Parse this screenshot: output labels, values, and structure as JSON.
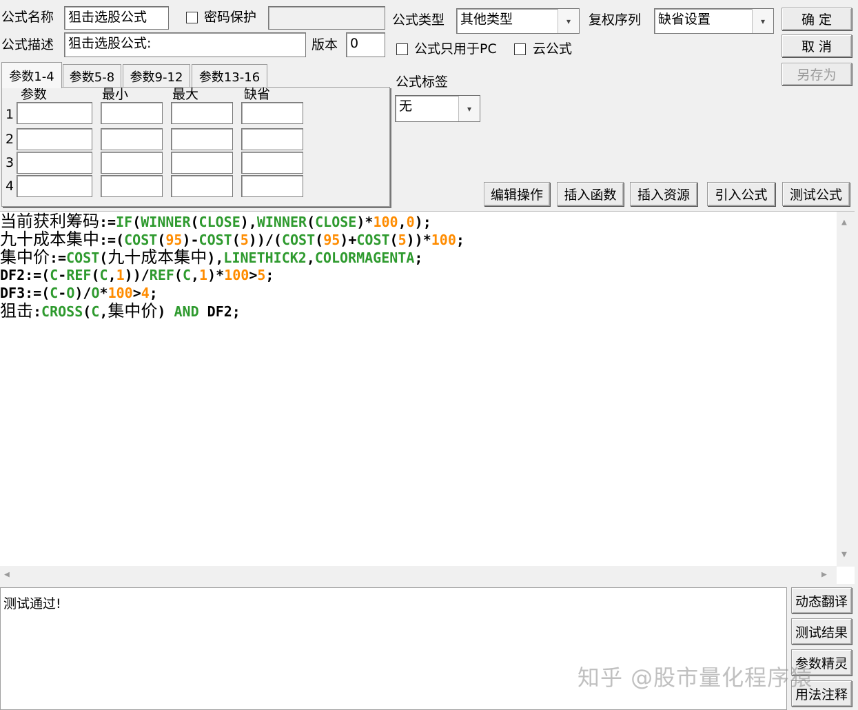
{
  "header": {
    "name_label": "公式名称",
    "name_value": "狙击选股公式",
    "password_label": "密码保护",
    "desc_label": "公式描述",
    "desc_value": "狙击选股公式:",
    "version_label": "版本",
    "version_value": "0",
    "type_label": "公式类型",
    "type_value": "其他类型",
    "rights_label": "复权序列",
    "rights_value": "缺省设置",
    "pc_only_label": "公式只用于PC",
    "cloud_label": "云公式",
    "tag_label": "公式标签",
    "tag_value": "无"
  },
  "buttons": {
    "ok": "确  定",
    "cancel": "取  消",
    "save_as": "另存为",
    "edit_ops": "编辑操作",
    "insert_func": "插入函数",
    "insert_res": "插入资源",
    "import_formula": "引入公式",
    "test_formula": "测试公式",
    "dyn_translate": "动态翻译",
    "test_result": "测试结果",
    "param_wizard": "参数精灵",
    "usage_notes": "用法注释"
  },
  "tabs": [
    "参数1-4",
    "参数5-8",
    "参数9-12",
    "参数13-16"
  ],
  "params": {
    "headers": [
      "参数",
      "最小",
      "最大",
      "缺省"
    ],
    "rows": [
      "1",
      "2",
      "3",
      "4"
    ]
  },
  "code": {
    "line1": {
      "a": "当前获利筹码",
      "b": ":=",
      "c": "IF",
      "d": "(",
      "e": "WINNER",
      "f": "(",
      "g": "CLOSE",
      "h": "),",
      "i": "WINNER",
      "j": "(",
      "k": "CLOSE",
      "l": ")*",
      "m": "100",
      "n": ",",
      "o": "0",
      "p": ");"
    },
    "line2": {
      "a": "九十成本集中",
      "b": ":=(",
      "c": "COST",
      "d": "(",
      "e": "95",
      "f": ")-",
      "g": "COST",
      "h": "(",
      "i": "5",
      "j": "))/(",
      "k": "COST",
      "l": "(",
      "m": "95",
      "n": ")+",
      "o": "COST",
      "p": "(",
      "q": "5",
      "r": "))*",
      "s": "100",
      "t": ";"
    },
    "line3": {
      "a": "集中价",
      "b": ":=",
      "c": "COST",
      "d": "(",
      "e": "九十成本集中",
      "f": "),",
      "g": "LINETHICK2",
      "h": ",",
      "i": "COLORMAGENTA",
      "j": ";"
    },
    "line4": {
      "a": "DF2:=(",
      "b": "C",
      "c": "-",
      "d": "REF",
      "e": "(",
      "f": "C",
      "g": ",",
      "h": "1",
      "i": "))/",
      "j": "REF",
      "k": "(",
      "l": "C",
      "m": ",",
      "n": "1",
      "o": ")*",
      "p": "100",
      "q": ">",
      "r": "5",
      "s": ";"
    },
    "line5": {
      "a": "DF3:=(",
      "b": "C",
      "c": "-",
      "d": "O",
      "e": ")/",
      "f": "O",
      "g": "*",
      "h": "100",
      "i": ">",
      "j": "4",
      "k": ";"
    },
    "line6": {
      "a": "狙击",
      "b": ":",
      "c": "CROSS",
      "d": "(",
      "e": "C",
      "f": ",",
      "g": "集中价",
      "h": ") ",
      "i": "AND",
      "j": " DF2;"
    }
  },
  "output": {
    "message": "测试通过!"
  },
  "watermark": "知乎 @股市量化程序猿",
  "icons": {
    "dropdown": "▾",
    "scroll_up": "▲",
    "scroll_down": "▼",
    "scroll_left": "◀",
    "scroll_right": "▶"
  }
}
